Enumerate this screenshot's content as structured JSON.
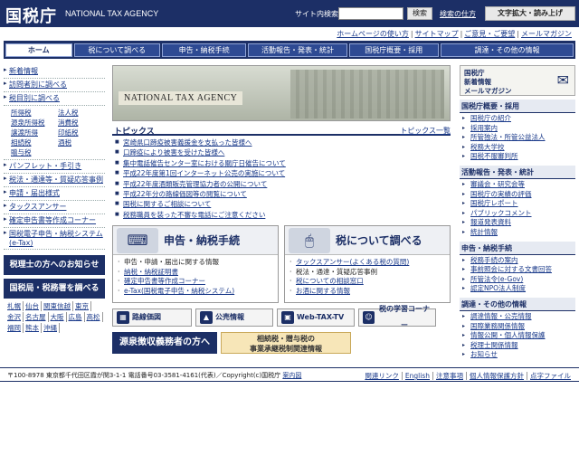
{
  "header": {
    "logo": "国税庁",
    "agency": "NATIONAL TAX AGENCY",
    "search_label": "サイト内検索",
    "search_button": "検索",
    "search_howto": "検索の仕方",
    "zoom_button": "文字拡大・読み上げ"
  },
  "utility": [
    "ホームページの使い方",
    "サイトマップ",
    "ご意見・ご要望",
    "メールマガジン"
  ],
  "nav": [
    "ホーム",
    "税について調べる",
    "申告・納税手続",
    "活動報告・発表・統計",
    "国税庁概要・採用",
    "調達・その他の情報"
  ],
  "left": {
    "items_top": [
      "新着情報",
      "訪問者別に調べる",
      "税目別に調べる"
    ],
    "tax_types": [
      "所得税",
      "法人税",
      "源泉所得税",
      "消費税",
      "譲渡所得",
      "印紙税",
      "相続税",
      "酒税",
      "贈与税"
    ],
    "items_bottom": [
      "パンフレット・手引き",
      "税法・通達等・質疑応答事例",
      "申請・届出様式",
      "タックスアンサー",
      "確定申告書等作成コーナー",
      "国税電子申告・納税システム(e-Tax)"
    ],
    "box1": "税理士の方へのお知らせ",
    "box2": "国税局・税務署を調べる",
    "bureaus": [
      "札幌",
      "仙台",
      "関東信越",
      "東京",
      "金沢",
      "名古屋",
      "大阪",
      "広島",
      "高松",
      "福岡",
      "熊本",
      "沖縄"
    ]
  },
  "main": {
    "banner": "NATIONAL TAX AGENCY",
    "topics_title": "トピックス",
    "topics_more": "トピックス一覧",
    "topics": [
      "宮崎県口蹄疫被害義援金を支払った皆様へ",
      "口蹄疫により被害を受けた皆様へ",
      "集中電話催告センター室における關庁日催告について",
      "平成22年度第1回インターネット公売の実施について",
      "平成22年度酒類販売管理協力者の公開について",
      "平成22年分の路線価図等の閲覧について",
      "国税に関するご相談について",
      "税務職員を装った不審な電話にご注意ください"
    ],
    "panel1": {
      "title": "申告・納税手続",
      "links": [
        "申告・申請・届出に関する情報",
        "納税・納税証明書",
        "確定申告書等作成コーナー",
        "e-Tax(国税電子申告・納税システム)"
      ]
    },
    "panel2": {
      "title": "税について調べる",
      "links": [
        "タックスアンサー(よくある税の質問)",
        "税法・通達・質疑応答事例",
        "税についての相談窓口",
        "お酒に関する情報"
      ]
    },
    "quicklinks": [
      "路線価図",
      "公売情報",
      "Web-TAX-TV",
      "税の学習コーナー"
    ],
    "bottom1": "源泉徴収義務者の方へ",
    "bottom2_line1": "相続税・贈与税の",
    "bottom2_line2": "事業承継税制関連情報"
  },
  "right": {
    "mag_line1": "国税庁",
    "mag_line2": "新着情報",
    "mag_line3": "メールマガジン",
    "sections": [
      {
        "title": "国税庁概要・採用",
        "links": [
          "国税庁の紹介",
          "採用案内",
          "所管独法・所管公益法人",
          "税務大学校",
          "国税不服審判所"
        ]
      },
      {
        "title": "活動報告・発表・統計",
        "links": [
          "審議会・研究会等",
          "国税庁の実績の評価",
          "国税庁レポート",
          "パブリックコメント",
          "報道発表資料",
          "統計情報"
        ]
      },
      {
        "title": "申告・納税手続",
        "links": [
          "税務手続の案内",
          "事前照会に対する文書回答",
          "所管法令(e-Gov)",
          "認定NPO法人制度"
        ]
      },
      {
        "title": "調達・その他の情報",
        "links": [
          "調達情報・公売情報",
          "国際業務関係情報",
          "情報公開・個人情報保護",
          "税理士関係情報",
          "お知らせ"
        ]
      }
    ]
  },
  "footer": {
    "address": "〒100-8978 東京都千代田区霞が関3-1-1 電話番号03-3581-4161(代表)／Copyright(c)国税庁",
    "map": "案内図",
    "links": [
      "関連リンク",
      "English",
      "注意事項",
      "個人情報保護方針",
      "点字ファイル"
    ]
  }
}
